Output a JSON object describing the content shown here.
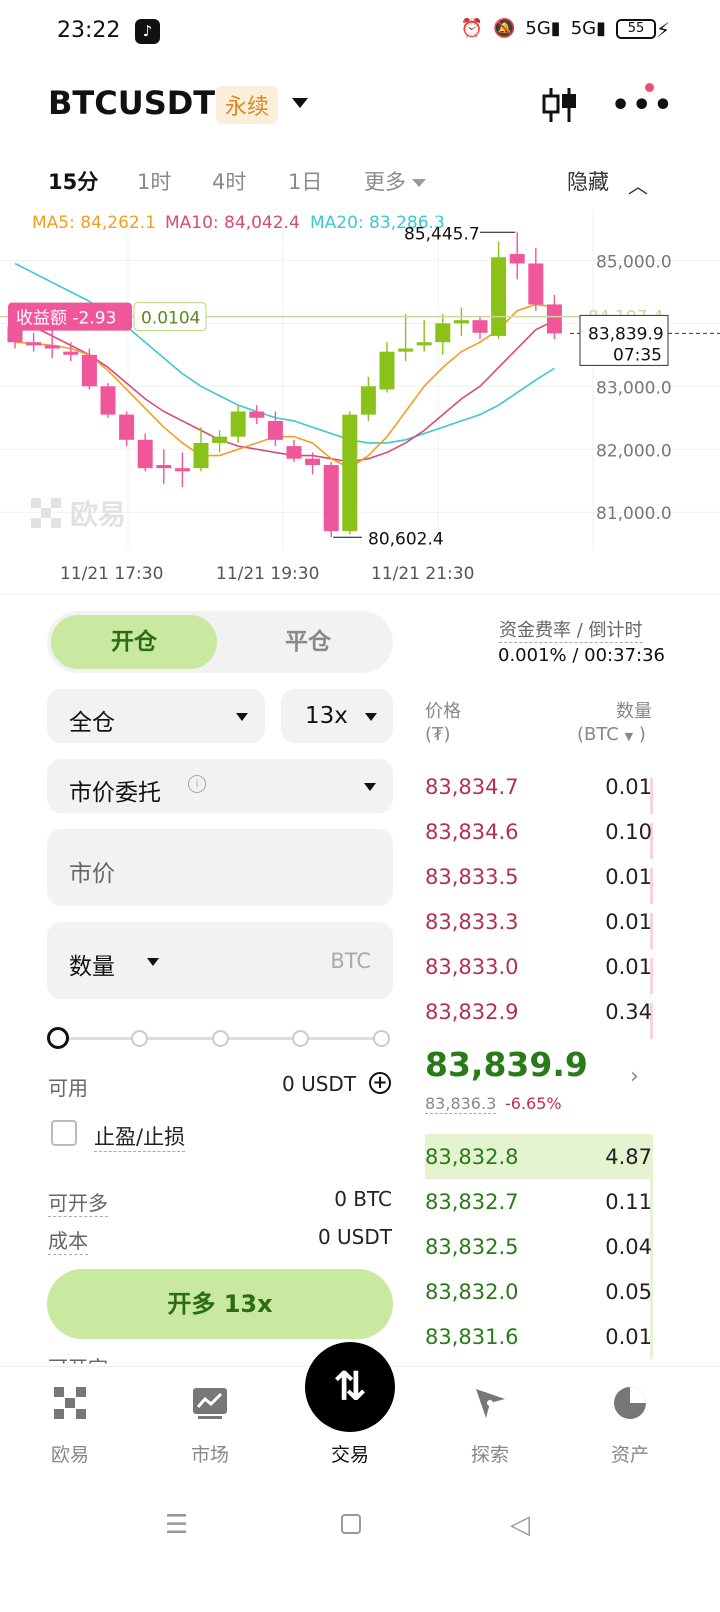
{
  "status_bar": {
    "time": "23:22",
    "battery": "55",
    "signal1": "5G",
    "signal2": "5G"
  },
  "header": {
    "symbol": "BTCUSDT",
    "badge": "永续"
  },
  "timeframes": {
    "items": [
      "15分",
      "1时",
      "4时",
      "1日"
    ],
    "more": "更多",
    "hide": "隐藏"
  },
  "chart": {
    "ma5": "MA5: 84,262.1",
    "ma10": "MA10: 84,042.4",
    "ma20": "MA20: 83,286.3",
    "y_ticks": [
      "85,000.0",
      "83,000.0",
      "82,000.0",
      "81,000.0"
    ],
    "high_label": "85,445.7",
    "low_label": "80,602.4",
    "pnl_label": "收益额 -2.93",
    "position_size": "0.0104",
    "entry_tick": "84,107.4",
    "last_price_label": "83,839.9",
    "countdown_label": "07:35",
    "x_ticks": [
      "11/21 17:30",
      "11/21 19:30",
      "11/21 21:30"
    ],
    "watermark": "欧易",
    "colors": {
      "up": "#8bc21a",
      "down": "#f0569a",
      "ma5": "#f0a020",
      "ma10": "#d9497a",
      "ma20": "#3cc8d0"
    }
  },
  "chart_data": {
    "type": "candlestick",
    "x": [
      "11/21 17:30",
      "11/21 19:30",
      "11/21 21:30"
    ],
    "ylim": [
      80400,
      85800
    ],
    "candles": [
      {
        "o": 83950,
        "h": 84150,
        "l": 83600,
        "c": 83700
      },
      {
        "o": 83700,
        "h": 83850,
        "l": 83550,
        "c": 83650
      },
      {
        "o": 83650,
        "h": 83900,
        "l": 83450,
        "c": 83600
      },
      {
        "o": 83550,
        "h": 83700,
        "l": 83400,
        "c": 83500
      },
      {
        "o": 83500,
        "h": 83600,
        "l": 82950,
        "c": 83000
      },
      {
        "o": 83000,
        "h": 83050,
        "l": 82500,
        "c": 82550
      },
      {
        "o": 82550,
        "h": 82600,
        "l": 82050,
        "c": 82150
      },
      {
        "o": 82150,
        "h": 82250,
        "l": 81650,
        "c": 81700
      },
      {
        "o": 81750,
        "h": 82000,
        "l": 81450,
        "c": 81700
      },
      {
        "o": 81700,
        "h": 81950,
        "l": 81400,
        "c": 81650
      },
      {
        "o": 81700,
        "h": 82350,
        "l": 81650,
        "c": 82100
      },
      {
        "o": 82100,
        "h": 82300,
        "l": 81950,
        "c": 82200
      },
      {
        "o": 82200,
        "h": 82700,
        "l": 82100,
        "c": 82600
      },
      {
        "o": 82600,
        "h": 82700,
        "l": 82400,
        "c": 82500
      },
      {
        "o": 82450,
        "h": 82600,
        "l": 82050,
        "c": 82150
      },
      {
        "o": 82050,
        "h": 82150,
        "l": 81800,
        "c": 81850
      },
      {
        "o": 81850,
        "h": 81950,
        "l": 81600,
        "c": 81750
      },
      {
        "o": 81750,
        "h": 81800,
        "l": 80602.4,
        "c": 80700
      },
      {
        "o": 80700,
        "h": 82600,
        "l": 80650,
        "c": 82550
      },
      {
        "o": 82550,
        "h": 83150,
        "l": 82450,
        "c": 83000
      },
      {
        "o": 82950,
        "h": 83700,
        "l": 82900,
        "c": 83550
      },
      {
        "o": 83550,
        "h": 84150,
        "l": 83400,
        "c": 83600
      },
      {
        "o": 83650,
        "h": 84050,
        "l": 83550,
        "c": 83700
      },
      {
        "o": 83700,
        "h": 84150,
        "l": 83500,
        "c": 84000
      },
      {
        "o": 84000,
        "h": 84250,
        "l": 83800,
        "c": 84050
      },
      {
        "o": 84050,
        "h": 84100,
        "l": 83750,
        "c": 83850
      },
      {
        "o": 83800,
        "h": 85300,
        "l": 83750,
        "c": 85050
      },
      {
        "o": 85100,
        "h": 85445.7,
        "l": 84700,
        "c": 84950
      },
      {
        "o": 84950,
        "h": 85200,
        "l": 84200,
        "c": 84300
      },
      {
        "o": 84300,
        "h": 84450,
        "l": 83750,
        "c": 83840
      }
    ],
    "ma5": [
      83700,
      83680,
      83650,
      83600,
      83500,
      83250,
      82950,
      82650,
      82350,
      82100,
      81900,
      81900,
      82000,
      82100,
      82200,
      82200,
      82100,
      81850,
      81700,
      81900,
      82200,
      82600,
      83000,
      83300,
      83550,
      83700,
      83900,
      84200,
      84300,
      84262.1
    ],
    "ma10": [
      84100,
      83950,
      83800,
      83650,
      83500,
      83300,
      83050,
      82800,
      82600,
      82450,
      82300,
      82150,
      82050,
      82000,
      81950,
      81900,
      81900,
      81850,
      81800,
      81850,
      81950,
      82100,
      82300,
      82550,
      82800,
      83000,
      83300,
      83600,
      83900,
      84042.4
    ],
    "ma20": [
      84950,
      84800,
      84650,
      84500,
      84350,
      84150,
      83950,
      83700,
      83450,
      83200,
      83000,
      82850,
      82700,
      82600,
      82500,
      82450,
      82350,
      82250,
      82150,
      82100,
      82100,
      82150,
      82250,
      82350,
      82450,
      82550,
      82700,
      82900,
      83100,
      83286.3
    ]
  },
  "trade": {
    "tab_open": "开仓",
    "tab_close": "平仓",
    "margin_mode": "全仓",
    "leverage": "13x",
    "order_type": "市价委托",
    "price_placeholder": "市价",
    "qty_label": "数量",
    "qty_unit": "BTC",
    "slider_percent": 0,
    "available_label": "可用",
    "available_value": "0 USDT",
    "tpsl_label": "止盈/止损",
    "max_open_label": "可开多",
    "max_open_value": "0 BTC",
    "cost_label": "成本",
    "cost_value": "0 USDT",
    "buy_button": "开多 13x",
    "cut_label": "可开空"
  },
  "funding": {
    "label": "资金费率 / 倒计时",
    "value": "0.001% / 00:37:36"
  },
  "orderbook": {
    "price_header": "价格",
    "price_unit": "(₮)",
    "qty_header": "数量",
    "qty_unit": "(BTC",
    "qty_unit_close": ")",
    "asks": [
      {
        "price": "83,834.7",
        "qty": "0.01",
        "depth": 0.02
      },
      {
        "price": "83,834.6",
        "qty": "0.10",
        "depth": 0.1
      },
      {
        "price": "83,833.5",
        "qty": "0.01",
        "depth": 0.02
      },
      {
        "price": "83,833.3",
        "qty": "0.01",
        "depth": 0.02
      },
      {
        "price": "83,833.0",
        "qty": "0.01",
        "depth": 0.02
      },
      {
        "price": "83,832.9",
        "qty": "0.34",
        "depth": 0.3
      }
    ],
    "last_price": "83,839.9",
    "mark_price": "83,836.3",
    "change": "-6.65%",
    "bids": [
      {
        "price": "83,832.8",
        "qty": "4.87",
        "depth": 1.0
      },
      {
        "price": "83,832.7",
        "qty": "0.11",
        "depth": 0.03
      },
      {
        "price": "83,832.5",
        "qty": "0.04",
        "depth": 0.02
      },
      {
        "price": "83,832.0",
        "qty": "0.05",
        "depth": 0.02
      },
      {
        "price": "83,831.6",
        "qty": "0.01",
        "depth": 0.01
      }
    ]
  },
  "nav": {
    "items": [
      "欧易",
      "市场",
      "交易",
      "探索",
      "资产"
    ]
  }
}
